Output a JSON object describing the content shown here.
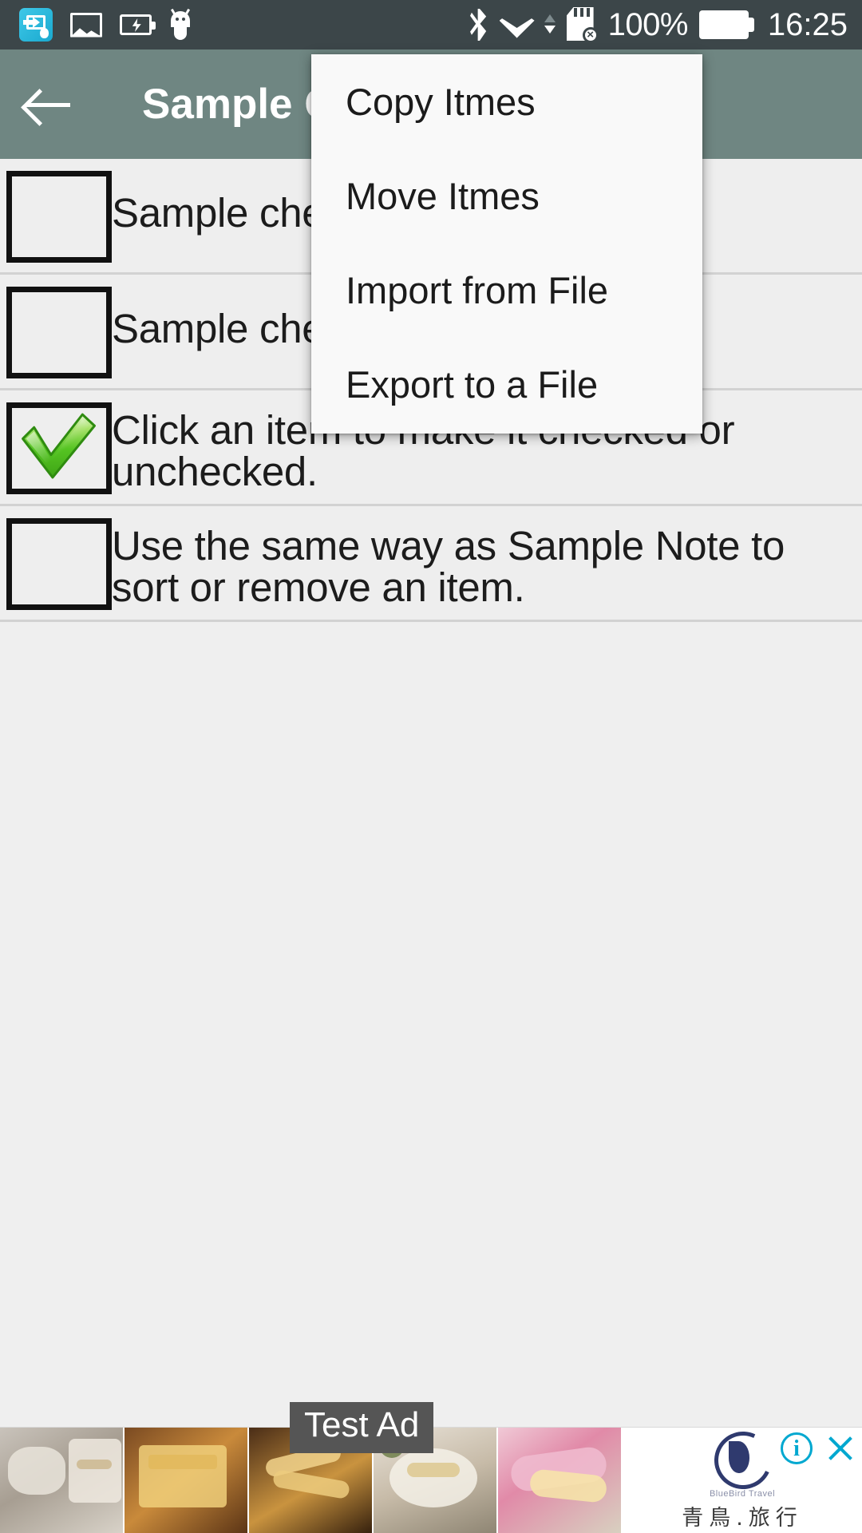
{
  "status_bar": {
    "background": "#3c4649",
    "left_icons": [
      {
        "name": "screen-cast-icon",
        "label": "cast"
      },
      {
        "name": "image-icon",
        "label": "image"
      },
      {
        "name": "battery-charging-icon",
        "label": "charging"
      },
      {
        "name": "android-icon",
        "label": "android"
      }
    ],
    "right_icons": [
      {
        "name": "bluetooth-icon",
        "label": "bluetooth"
      },
      {
        "name": "wifi-icon",
        "label": "wifi"
      },
      {
        "name": "sd-card-error-icon",
        "label": "sd card error"
      }
    ],
    "battery_percent": "100%",
    "clock": "16:25"
  },
  "toolbar": {
    "background": "#6f8682",
    "back_label": "Back",
    "title": "Sample Checklist"
  },
  "menu": {
    "background": "#f9f9f9",
    "items": [
      {
        "label": "Copy Itmes"
      },
      {
        "label": "Move Itmes"
      },
      {
        "label": "Import from File"
      },
      {
        "label": "Export to a File"
      }
    ]
  },
  "checklist": {
    "items": [
      {
        "text": "Sample checklist item.",
        "checked": false
      },
      {
        "text": "Sample checklist item.",
        "checked": false
      },
      {
        "text": "Click an item to make it checked or unchecked.",
        "checked": true
      },
      {
        "text": "Use the same way as Sample Note to sort or remove an item.",
        "checked": false
      }
    ],
    "check_color": "#4fbf20"
  },
  "ad": {
    "label": "Test Ad",
    "brand_sub": "BlueBird Travel",
    "brand_cn": "青鳥.旅行",
    "info_glyph": "i",
    "close_glyph": "×",
    "accent": "#00a8d0"
  }
}
